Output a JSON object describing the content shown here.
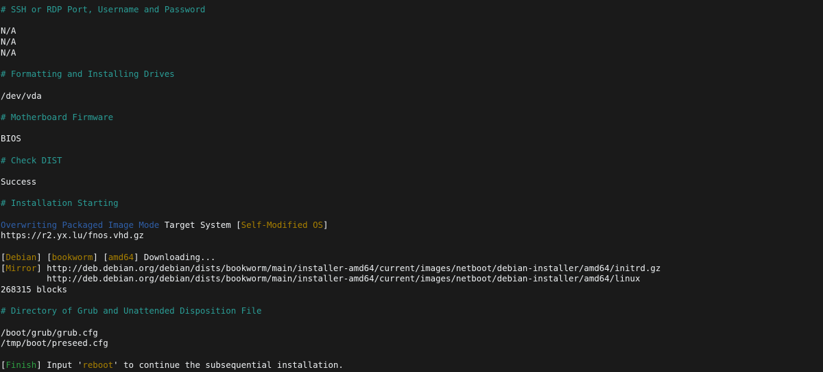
{
  "terminal": {
    "background_color": "#1a1a1a",
    "colors": {
      "comment_teal": "#2a9d96",
      "plain_white": "#eceff1",
      "mode_blue": "#2f5fa8",
      "tag_gold": "#a98000",
      "finish_green": "#2ea043"
    },
    "lines": [
      {
        "type": "comment",
        "text": "# SSH or RDP Port, Username and Password"
      },
      {
        "type": "blank",
        "text": ""
      },
      {
        "type": "plain",
        "text": "N/A"
      },
      {
        "type": "plain",
        "text": "N/A"
      },
      {
        "type": "plain",
        "text": "N/A"
      },
      {
        "type": "blank",
        "text": ""
      },
      {
        "type": "comment",
        "text": "# Formatting and Installing Drives"
      },
      {
        "type": "blank",
        "text": ""
      },
      {
        "type": "plain",
        "text": "/dev/vda"
      },
      {
        "type": "blank",
        "text": ""
      },
      {
        "type": "comment",
        "text": "# Motherboard Firmware"
      },
      {
        "type": "blank",
        "text": ""
      },
      {
        "type": "plain",
        "text": "BIOS"
      },
      {
        "type": "blank",
        "text": ""
      },
      {
        "type": "comment",
        "text": "# Check DIST"
      },
      {
        "type": "blank",
        "text": ""
      },
      {
        "type": "plain",
        "text": "Success"
      },
      {
        "type": "blank",
        "text": ""
      },
      {
        "type": "comment",
        "text": "# Installation Starting"
      },
      {
        "type": "blank",
        "text": ""
      },
      {
        "type": "rich",
        "name": "overwrite-mode-line",
        "spans": [
          {
            "color": "mode_blue",
            "text": "Overwriting Packaged Image Mode"
          },
          {
            "color": "plain_white",
            "text": " Target System "
          },
          {
            "color": "plain_white",
            "text": "["
          },
          {
            "color": "tag_gold",
            "text": "Self-Modified OS"
          },
          {
            "color": "plain_white",
            "text": "]"
          }
        ]
      },
      {
        "type": "plain",
        "text": "https://r2.yx.lu/fnos.vhd.gz"
      },
      {
        "type": "blank",
        "text": ""
      },
      {
        "type": "rich",
        "name": "debian-download-line",
        "spans": [
          {
            "color": "plain_white",
            "text": "["
          },
          {
            "color": "tag_gold",
            "text": "Debian"
          },
          {
            "color": "plain_white",
            "text": "] ["
          },
          {
            "color": "tag_gold",
            "text": "bookworm"
          },
          {
            "color": "plain_white",
            "text": "] ["
          },
          {
            "color": "tag_gold",
            "text": "amd64"
          },
          {
            "color": "plain_white",
            "text": "] Downloading..."
          }
        ]
      },
      {
        "type": "rich",
        "name": "mirror-initrd-line",
        "spans": [
          {
            "color": "plain_white",
            "text": "["
          },
          {
            "color": "tag_gold",
            "text": "Mirror"
          },
          {
            "color": "plain_white",
            "text": "] http://deb.debian.org/debian/dists/bookworm/main/installer-amd64/current/images/netboot/debian-installer/amd64/initrd.gz"
          }
        ]
      },
      {
        "type": "plain",
        "text": "         http://deb.debian.org/debian/dists/bookworm/main/installer-amd64/current/images/netboot/debian-installer/amd64/linux"
      },
      {
        "type": "plain",
        "text": "268315 blocks"
      },
      {
        "type": "blank",
        "text": ""
      },
      {
        "type": "comment",
        "text": "# Directory of Grub and Unattended Disposition File"
      },
      {
        "type": "blank",
        "text": ""
      },
      {
        "type": "plain",
        "text": "/boot/grub/grub.cfg"
      },
      {
        "type": "plain",
        "text": "/tmp/boot/preseed.cfg"
      },
      {
        "type": "blank",
        "text": ""
      },
      {
        "type": "rich",
        "name": "finish-line",
        "spans": [
          {
            "color": "plain_white",
            "text": "["
          },
          {
            "color": "finish_green",
            "text": "Finish"
          },
          {
            "color": "plain_white",
            "text": "] Input '"
          },
          {
            "color": "tag_gold",
            "text": "reboot"
          },
          {
            "color": "plain_white",
            "text": "' to continue the subsequential installation."
          }
        ]
      }
    ]
  }
}
